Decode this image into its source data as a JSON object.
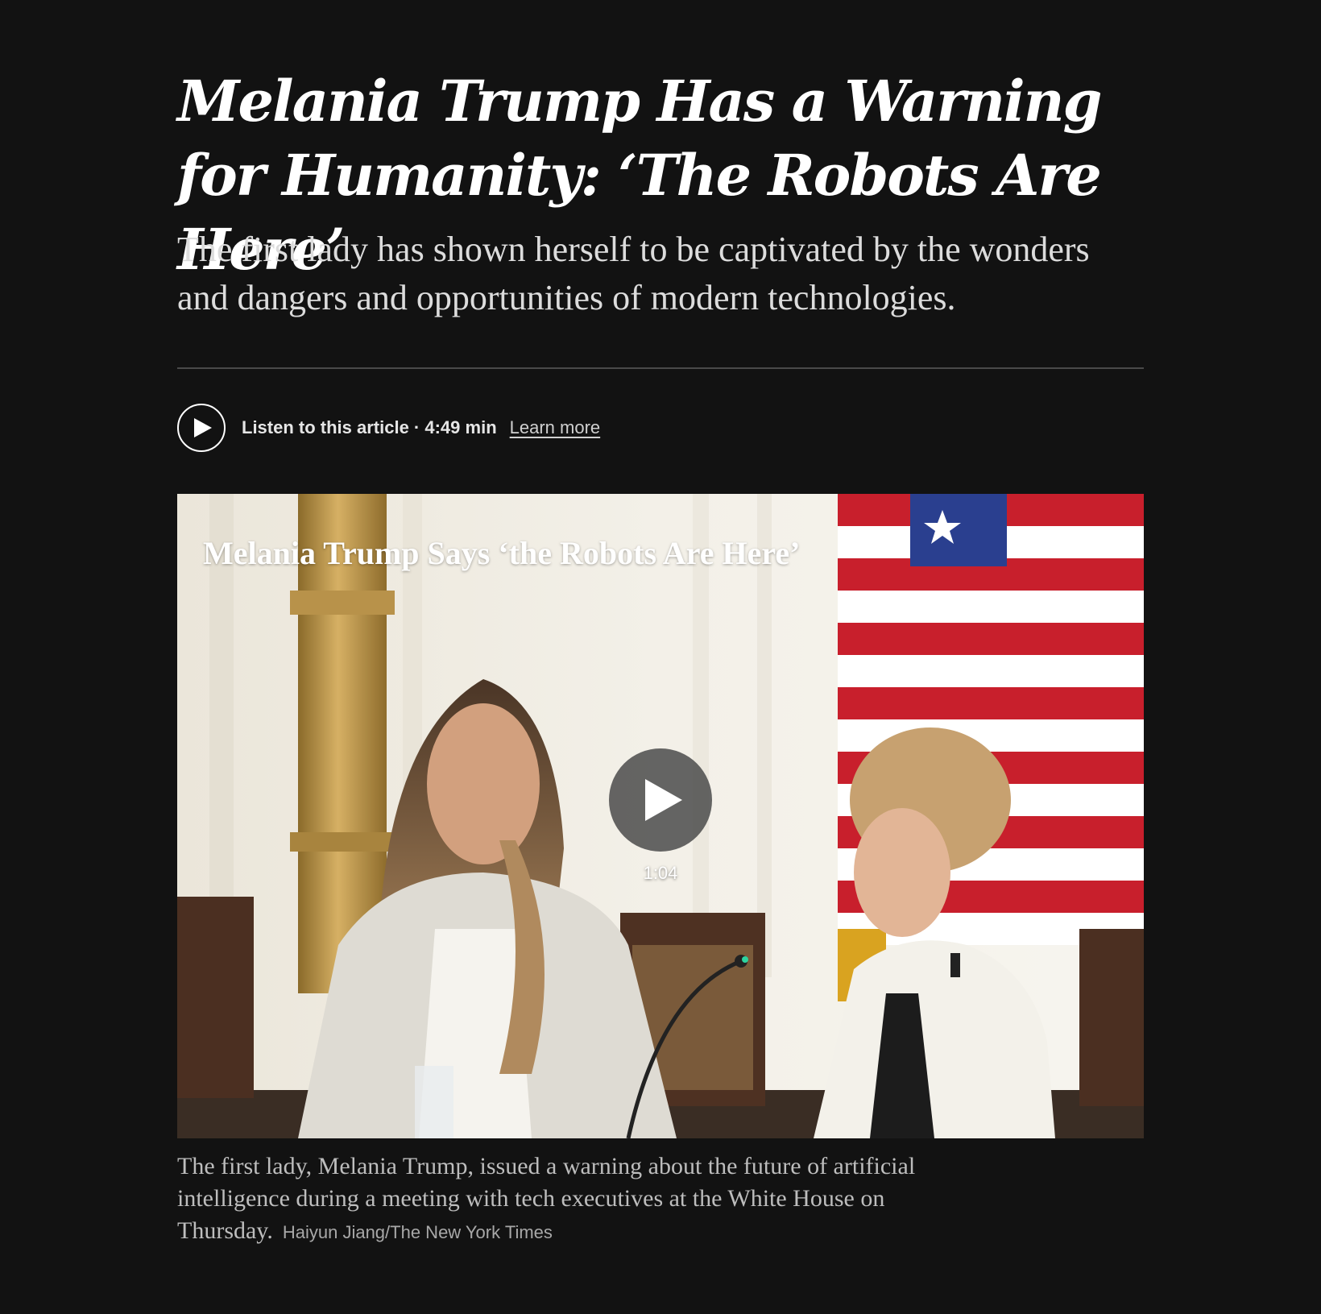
{
  "article": {
    "headline": "Melania Trump Has a Warning for Humanity: ‘The Robots Are Here’",
    "summary": "The first lady has shown herself to be captivated by the wonders and dangers and opportunities of modern technologies."
  },
  "audio": {
    "label": "Listen to this article · 4:49 min",
    "learn_more": "Learn more",
    "icon": "play-icon"
  },
  "video": {
    "title": "Melania Trump Says ‘the Robots Are Here’",
    "duration": "1:04",
    "icon": "play-icon"
  },
  "caption": {
    "text": "The first lady, Melania Trump, issued a warning about the future of artificial intelligence during a meeting with tech executives at the White House on Thursday.",
    "credit": "Haiyun Jiang/The New York Times"
  },
  "colors": {
    "background": "#121212",
    "text": "#ffffff",
    "muted": "#bdbdbd"
  }
}
